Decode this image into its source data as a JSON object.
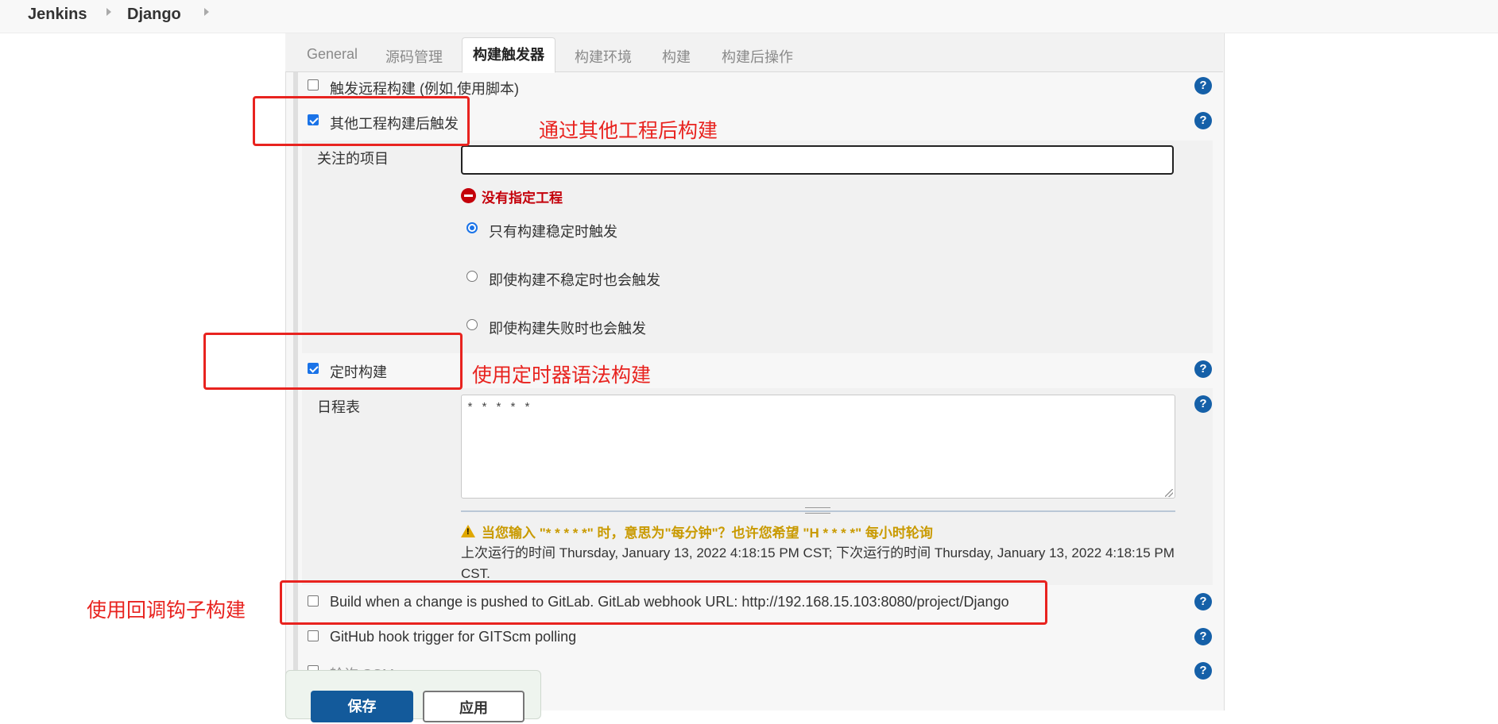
{
  "breadcrumb": {
    "home": "Jenkins",
    "project": "Django"
  },
  "tabs": [
    "General",
    "源码管理",
    "构建触发器",
    "构建环境",
    "构建",
    "构建后操作"
  ],
  "active_tab": "构建触发器",
  "triggers": {
    "remote": {
      "label": "触发远程构建 (例如,使用脚本)",
      "checked": false
    },
    "after_other": {
      "label": "其他工程构建后触发",
      "checked": true
    },
    "watched_label": "关注的项目",
    "watched_value": "",
    "error": "没有指定工程",
    "radio_options": [
      {
        "label": "只有构建稳定时触发",
        "selected": true
      },
      {
        "label": "即使构建不稳定时也会触发",
        "selected": false
      },
      {
        "label": "即使构建失败时也会触发",
        "selected": false
      }
    ],
    "timer": {
      "label": "定时构建",
      "checked": true
    },
    "schedule_label": "日程表",
    "schedule_value": "* * * * *",
    "warning": "当您输入 \"* * * * *\" 时，意思为\"每分钟\"？也许您希望 \"H * * * *\" 每小时轮询",
    "run_info": "上次运行的时间 Thursday, January 13, 2022 4:18:15 PM CST; 下次运行的时间 Thursday, January 13, 2022 4:18:15 PM CST.",
    "gitlab": {
      "label": "Build when a change is pushed to GitLab. GitLab webhook URL: http://192.168.15.103:8080/project/Django",
      "checked": false
    },
    "github": {
      "label": "GitHub hook trigger for GITScm polling",
      "checked": false
    },
    "scm": {
      "label": "轮询 SCM",
      "checked": false
    }
  },
  "annotations": {
    "after_other_note": "通过其他工程后构建",
    "timer_note": "使用定时器语法构建",
    "gitlab_note": "使用回调钩子构建",
    "color": "#e8231f"
  },
  "help_icon": "?",
  "buttons": {
    "save": "保存",
    "apply": "应用"
  },
  "colors": {
    "accent": "#1a73e8",
    "help": "#1560a8",
    "error": "#c4000a",
    "warning": "#c99a00"
  }
}
